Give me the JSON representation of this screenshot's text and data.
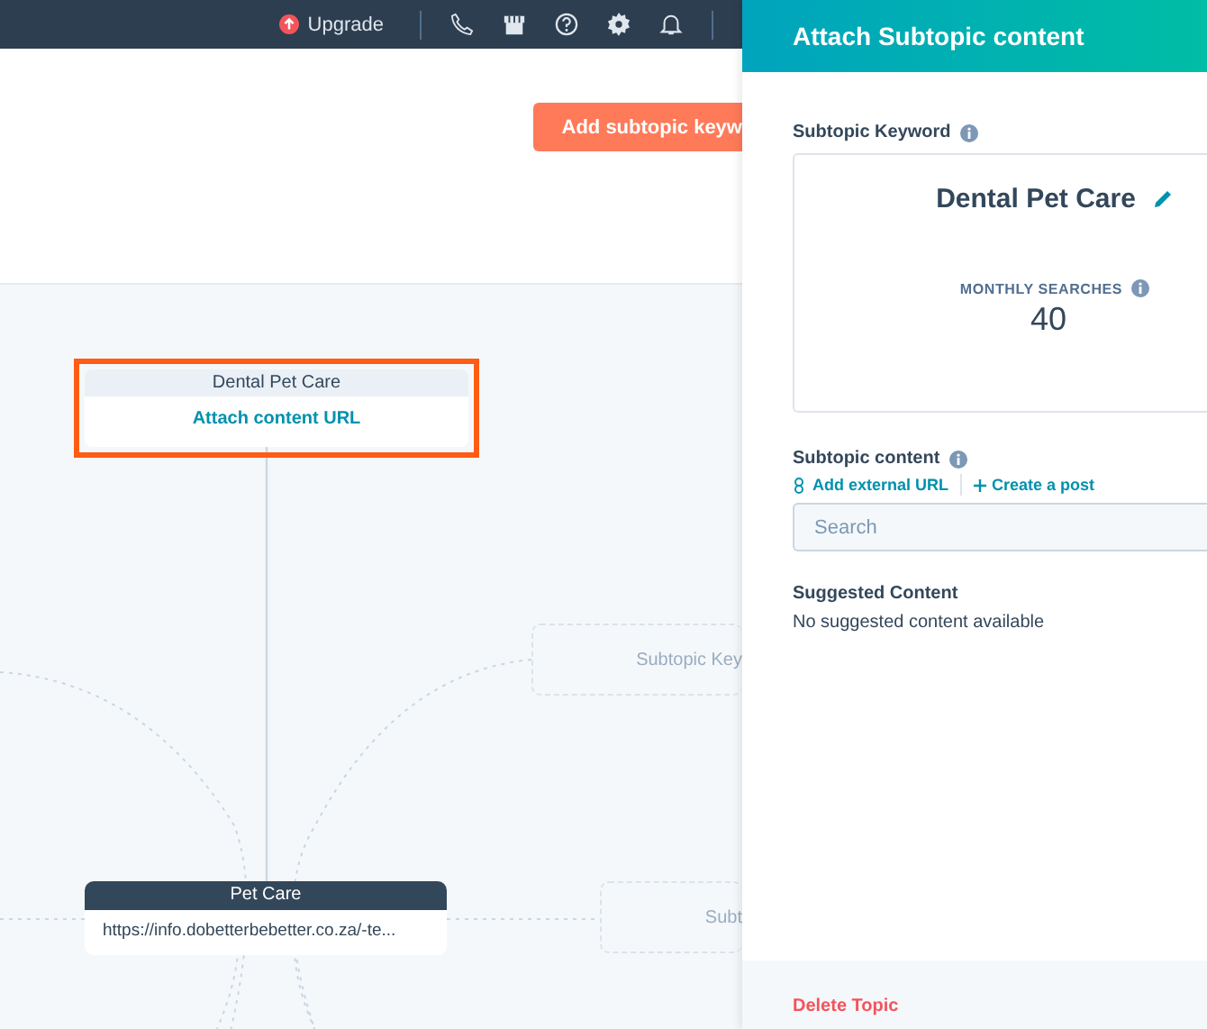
{
  "top_bar": {
    "upgrade": "Upgrade"
  },
  "toolbar": {
    "add_button": "Add subtopic keyw"
  },
  "canvas": {
    "selected_node": {
      "title": "Dental Pet Care",
      "link": "Attach content URL",
      "selected": true
    },
    "pillar_node": {
      "title": "Pet Care",
      "url": "https://info.dobetterbebetter.co.za/-te..."
    },
    "placeholder_nodes": [
      {
        "label": "Subtopic Key"
      },
      {
        "label": "Subt"
      }
    ]
  },
  "panel": {
    "title": "Attach Subtopic content",
    "keyword_label": "Subtopic Keyword",
    "keyword": "Dental Pet Care",
    "searches_label": "MONTHLY SEARCHES",
    "searches": "40",
    "content_label": "Subtopic content",
    "actions": [
      "Add external URL",
      "Create a post"
    ],
    "search": {
      "placeholder": "Search"
    },
    "suggested_label": "Suggested Content",
    "suggested_empty": "No suggested content available",
    "delete": "Delete Topic"
  }
}
